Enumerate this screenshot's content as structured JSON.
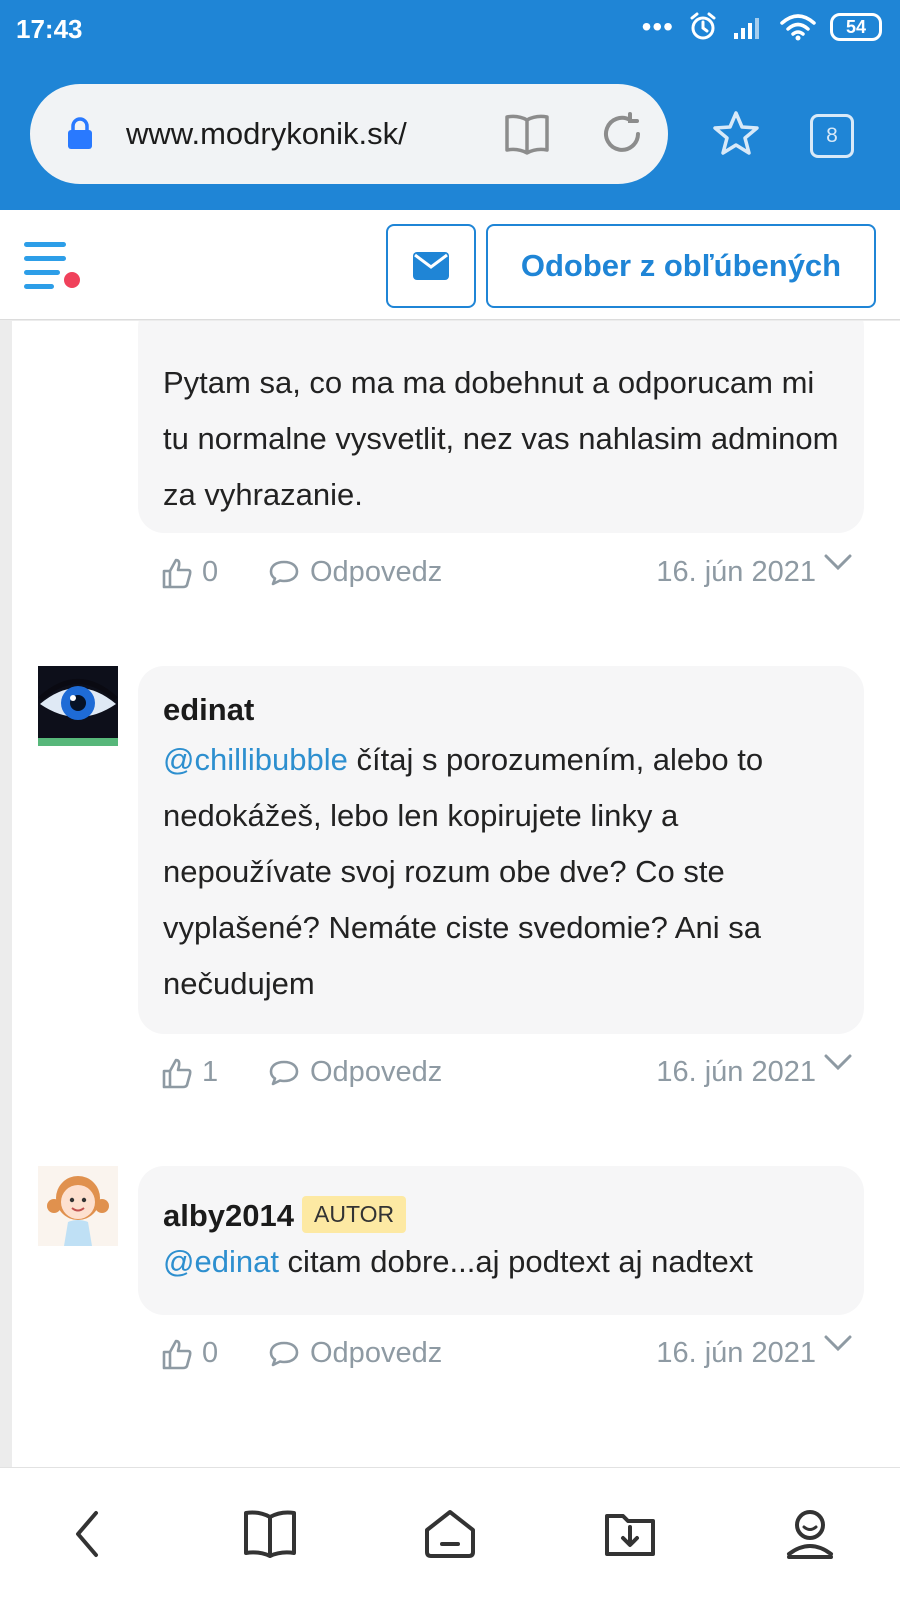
{
  "status": {
    "time": "17:43",
    "dots": "•••",
    "battery": "54"
  },
  "browser": {
    "url": "www.modrykonik.sk/",
    "tab_count": "8"
  },
  "header": {
    "unfavorite_label": "Odober z obľúbených"
  },
  "comments": [
    {
      "text": "Pytam sa, co ma ma dobehnut a odporucam mi tu normalne vysvetlit, nez vas nahlasim adminom za vyhrazanie.",
      "likes": "0",
      "reply_label": "Odpovedz",
      "date": "16. jún 2021"
    },
    {
      "author": "edinat",
      "mention": "@chillibubble",
      "text": " čítaj s porozumením, alebo to nedokážeš, lebo len kopirujete linky a nepoužívate svoj rozum obe dve? Co ste vyplašené? Nemáte ciste svedomie? Ani sa nečudujem",
      "likes": "1",
      "reply_label": "Odpovedz",
      "date": "16. jún 2021"
    },
    {
      "author": "alby2014",
      "badge": "AUTOR",
      "mention": "@edinat",
      "text": " citam dobre...aj podtext aj nadtext",
      "likes": "0",
      "reply_label": "Odpovedz",
      "date": "16. jún 2021"
    }
  ],
  "icons": {
    "lock": "lock-icon",
    "reader": "reader-mode-icon",
    "reload": "reload-icon",
    "star": "star-icon",
    "mail": "mail-icon",
    "menu": "menu-icon",
    "like": "thumbs-up-icon",
    "reply": "reply-icon",
    "chevron": "chevron-down-icon",
    "back": "back-icon",
    "book": "bookmarks-icon",
    "home": "home-icon",
    "download": "download-icon",
    "profile": "profile-icon"
  },
  "colors": {
    "accent": "#1f85d6",
    "mention": "#2d8fcf",
    "badge": "#fde9a3",
    "notification": "#f0415b"
  }
}
